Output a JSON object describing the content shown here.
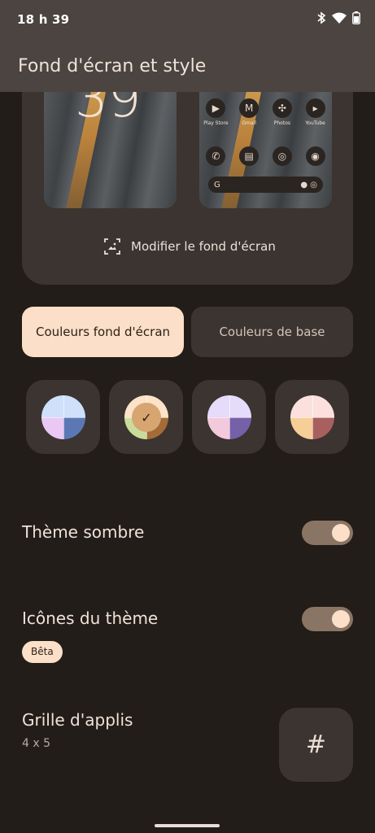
{
  "status": {
    "time": "18 h 39"
  },
  "appbar": {
    "title": "Fond d'écran et style"
  },
  "preview": {
    "clock": "39",
    "apps_row1": [
      "Play Store",
      "Gmail",
      "Photos",
      "YouTube"
    ],
    "modify_label": "Modifier le fond d'écran"
  },
  "tabs": {
    "wallpaper_colors": "Couleurs fond d'écran",
    "basic_colors": "Couleurs de base"
  },
  "swatches": [
    {
      "colors": [
        "#cfe0fb",
        "#cfe0fb",
        "#e9c8f3",
        "#5b78b5"
      ],
      "selected": false
    },
    {
      "colors": [
        "#fbe2c9",
        "#fbe2c9",
        "#c9dc9b",
        "#a26b38"
      ],
      "selected": true
    },
    {
      "colors": [
        "#e5dcfb",
        "#e5dcfb",
        "#f3c9dc",
        "#7561a8"
      ],
      "selected": false
    },
    {
      "colors": [
        "#fbe0de",
        "#fbe0de",
        "#f6cf98",
        "#a8605f"
      ],
      "selected": false
    }
  ],
  "settings": {
    "dark_theme": {
      "title": "Thème sombre",
      "enabled": true
    },
    "theme_icons": {
      "title": "Icônes du thème",
      "badge": "Bêta",
      "enabled": true
    },
    "app_grid": {
      "title": "Grille d'applis",
      "value": "4 x 5"
    }
  }
}
